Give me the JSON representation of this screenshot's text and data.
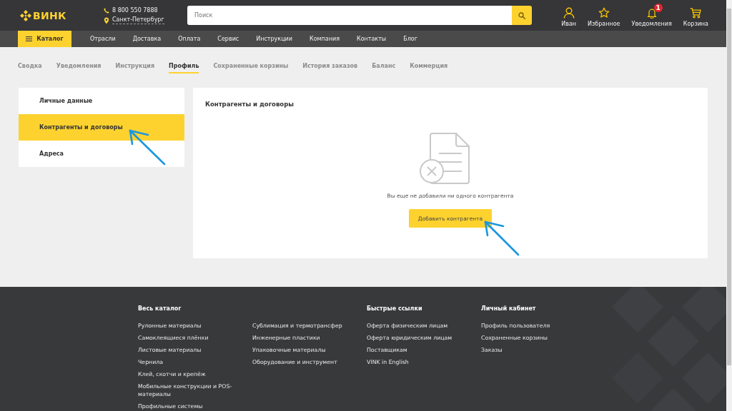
{
  "header": {
    "logo": "ВИНК",
    "phone": "8 800 550 7888",
    "city": "Санкт-Петербург",
    "search": {
      "placeholder": "Поиск"
    },
    "actions": [
      {
        "kind": "user",
        "label": "Иван"
      },
      {
        "kind": "star",
        "label": "Избранное"
      },
      {
        "kind": "bell",
        "label": "Уведомления",
        "badge": "1"
      },
      {
        "kind": "cart",
        "label": "Корзина"
      }
    ]
  },
  "nav": {
    "catalog": "Каталог",
    "items": [
      "Отрасли",
      "Доставка",
      "Оплата",
      "Сервис",
      "Инструкции",
      "Компания",
      "Контакты",
      "Блог"
    ]
  },
  "tabs": [
    {
      "label": "Сводка",
      "selected": false
    },
    {
      "label": "Уведомления",
      "selected": false
    },
    {
      "label": "Инструкция",
      "selected": false
    },
    {
      "label": "Профиль",
      "selected": true
    },
    {
      "label": "Сохраненные корзины",
      "selected": false
    },
    {
      "label": "История заказов",
      "selected": false
    },
    {
      "label": "Баланс",
      "selected": false
    },
    {
      "label": "Коммерция",
      "selected": false
    }
  ],
  "sidebar": {
    "items": [
      {
        "label": "Личные данные",
        "selected": false
      },
      {
        "label": "Контрагенты и договоры",
        "selected": true
      },
      {
        "label": "Адреса",
        "selected": false
      }
    ]
  },
  "content": {
    "title": "Контрагенты и договоры",
    "empty_message": "Вы еще не добавили ни одного контрагента",
    "button": "Добавить контрагента"
  },
  "footer": {
    "columns": [
      {
        "heading": "Весь каталог",
        "links": [
          "Рулонные материалы",
          "Самоклеящиеся плёнки",
          "Листовые материалы",
          "Чернила",
          "Клей, скотчи и крепёж",
          "Мобильные конструкции и POS-материалы",
          "Профильные системы"
        ]
      },
      {
        "links": [
          "Сублимация и термотрансфер",
          "Инженерные пластики",
          "Упаковочные материалы",
          "Оборудование и инструмент"
        ]
      },
      {
        "heading": "Быстрые ссылки",
        "links": [
          "Оферта физическим лицам",
          "Оферта юридическим лицам",
          "Поставщикам",
          "VINK in English"
        ]
      },
      {
        "heading": "Личный кабинет",
        "links": [
          "Профиль пользователя",
          "Сохраненные корзины",
          "Заказы"
        ]
      }
    ]
  }
}
